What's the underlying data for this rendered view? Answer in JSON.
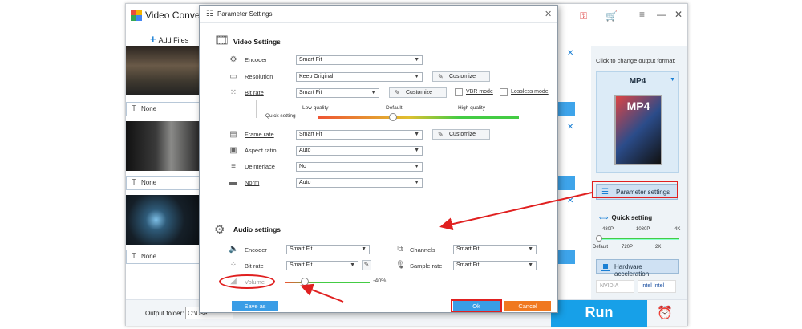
{
  "app": {
    "title": "Video Converter",
    "add_files": "Add Files",
    "subtitle_none": "None",
    "right_pane": {
      "change_format_label": "Click to change output format:",
      "format": "MP4",
      "format_icon_text": "MP4",
      "param_settings_label": "Parameter settings",
      "quick_setting_label": "Quick setting",
      "top_ticks": [
        "480P",
        "1080P",
        "4K"
      ],
      "bottom_ticks": [
        "Default",
        "720P",
        "2K"
      ],
      "hw_accel_label": "Hardware acceleration",
      "vendors": [
        "NVIDIA",
        "intel Intel"
      ]
    },
    "output_folder_label": "Output folder:",
    "output_folder_value": "C:\\Use",
    "run_label": "Run"
  },
  "dialog": {
    "title": "Parameter Settings",
    "video_section": "Video Settings",
    "video_rows": {
      "encoder": {
        "label": "Encoder",
        "value": "Smart Fit"
      },
      "resolution": {
        "label": "Resolution",
        "value": "Keep Original",
        "button": "Customize"
      },
      "bitrate": {
        "label": "Bit rate",
        "value": "Smart Fit",
        "button": "Customize",
        "vbr": "VBR mode",
        "lossless": "Lossless mode"
      },
      "framerate": {
        "label": "Frame rate",
        "value": "Smart Fit",
        "button": "Customize"
      },
      "aspect": {
        "label": "Aspect ratio",
        "value": "Auto"
      },
      "deinterlace": {
        "label": "Deinterlace",
        "value": "No"
      },
      "norm": {
        "label": "Norm",
        "value": "Auto"
      }
    },
    "quality": {
      "title": "Quick setting",
      "low": "Low quality",
      "default": "Default",
      "high": "High quality"
    },
    "audio_section": "Audio settings",
    "audio_rows": {
      "encoder": {
        "label": "Encoder",
        "value": "Smart Fit"
      },
      "channels": {
        "label": "Channels",
        "value": "Smart Fit"
      },
      "bitrate": {
        "label": "Bit rate",
        "value": "Smart Fit"
      },
      "samplerate": {
        "label": "Sample rate",
        "value": "Smart Fit"
      },
      "volume": {
        "label": "Volume",
        "value": "-40%"
      }
    },
    "buttons": {
      "save_as": "Save as",
      "ok": "Ok",
      "cancel": "Cancel"
    }
  },
  "colors": {
    "accent": "#17a0e8",
    "annotation": "#e02020",
    "cancel": "#f07820"
  }
}
